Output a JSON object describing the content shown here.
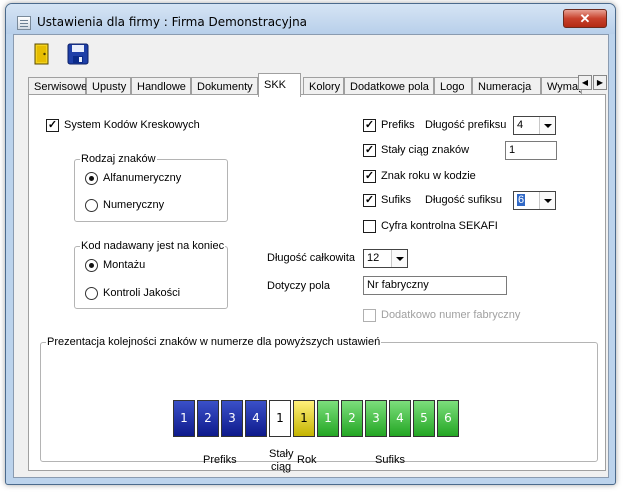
{
  "window": {
    "title": "Ustawienia dla firmy  : Firma Demonstracyjna",
    "close_glyph": "✕"
  },
  "toolbar": {
    "buttons": [
      "door-icon",
      "save-icon"
    ]
  },
  "tabs": [
    "Serwisowe",
    "Upusty",
    "Handlowe",
    "Dokumenty",
    "SKK",
    "Kolory",
    "Dodatkowe pola",
    "Logo",
    "Numeracja",
    "Wymag"
  ],
  "active_tab": "SKK",
  "form": {
    "system_kodow": {
      "label": "System Kodów Kreskowych",
      "checked": true
    },
    "rodzaj": {
      "legend": "Rodzaj znaków",
      "options": [
        {
          "label": "Alfanumeryczny",
          "selected": true
        },
        {
          "label": "Numeryczny",
          "selected": false
        }
      ]
    },
    "kod_nadawany": {
      "legend": "Kod nadawany jest na koniec",
      "options": [
        {
          "label": "Montażu",
          "selected": true
        },
        {
          "label": "Kontroli Jakości",
          "selected": false
        }
      ]
    },
    "prefiks": {
      "label": "Prefiks",
      "checked": true,
      "length_label": "Długość prefiksu",
      "length_value": "4"
    },
    "staly_ciag": {
      "label": "Stały ciąg znaków",
      "checked": true,
      "value": "1"
    },
    "znak_roku": {
      "label": "Znak roku w kodzie",
      "checked": true
    },
    "sufiks": {
      "label": "Sufiks",
      "checked": true,
      "length_label": "Długość sufiksu",
      "length_value": "6"
    },
    "cyfra_kontrolna": {
      "label": "Cyfra kontrolna SEKAFI",
      "checked": false
    },
    "dlugosc_calkowita": {
      "label": "Długość całkowita",
      "value": "12"
    },
    "dotyczy_pola": {
      "label": "Dotyczy pola",
      "value": "Nr fabryczny"
    },
    "dodatkowo": {
      "label": "Dodatkowo numer fabryczny",
      "checked": false,
      "disabled": true
    }
  },
  "presentation": {
    "legend": "Prezentacja kolejności znaków w numerze dla powyższych ustawień",
    "boxes": [
      {
        "text": "1",
        "kind": "blue"
      },
      {
        "text": "2",
        "kind": "blue"
      },
      {
        "text": "3",
        "kind": "blue"
      },
      {
        "text": "4",
        "kind": "blue"
      },
      {
        "text": "1",
        "kind": "white"
      },
      {
        "text": "1",
        "kind": "yellow"
      },
      {
        "text": "1",
        "kind": "green"
      },
      {
        "text": "2",
        "kind": "green"
      },
      {
        "text": "3",
        "kind": "green"
      },
      {
        "text": "4",
        "kind": "green"
      },
      {
        "text": "5",
        "kind": "green"
      },
      {
        "text": "6",
        "kind": "green"
      }
    ],
    "captions": {
      "prefiks": "Prefiks",
      "staly_1": "Stały",
      "staly_2": "ciąg",
      "rok": "Rok",
      "sufiks": "Sufiks"
    }
  },
  "colors": {
    "blue": "#1a2fa8",
    "yellow": "#e6d800",
    "green": "#3cbf3c",
    "selection": "#3169c6"
  }
}
